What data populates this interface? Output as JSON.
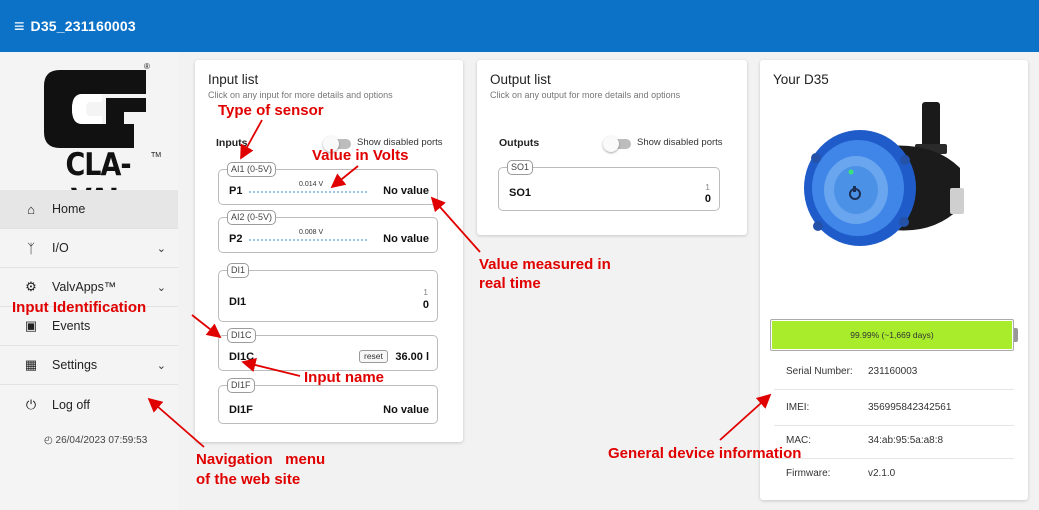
{
  "header": {
    "title": "D35_231160003",
    "menu_icon": "hamburger-icon",
    "color": "#0b72c7"
  },
  "logo": {
    "text": "CLA-VAL",
    "registered": "®",
    "trademark": "TM"
  },
  "sidebar": {
    "items": [
      {
        "label": "Home",
        "icon": "home-icon"
      },
      {
        "label": "I/O",
        "icon": "io-icon"
      },
      {
        "label": "ValvApps™",
        "icon": "valvapps-icon"
      },
      {
        "label": "Events",
        "icon": "calendar-icon"
      },
      {
        "label": "Settings",
        "icon": "settings-icon"
      },
      {
        "label": "Log off",
        "icon": "power-icon"
      }
    ],
    "timestamp": "26/04/2023 07:59:53"
  },
  "input_list": {
    "title": "Input list",
    "subtitle": "Click on any input for more details and options",
    "section": "Inputs",
    "toggle_label": "Show disabled ports",
    "ports": [
      {
        "tag": "AI1 (0-5V)",
        "name": "P1",
        "volt": "0.014 V",
        "value": "No value"
      },
      {
        "tag": "AI2 (0-5V)",
        "name": "P2",
        "volt": "0.008 V",
        "value": "No value"
      },
      {
        "tag": "DI1",
        "name": "DI1",
        "count_small": "1",
        "count_big": "0"
      },
      {
        "tag": "DI1C",
        "name": "DI1C",
        "reset": "reset",
        "value": "36.00 l"
      },
      {
        "tag": "DI1F",
        "name": "DI1F",
        "value": "No value"
      }
    ]
  },
  "output_list": {
    "title": "Output list",
    "subtitle": "Click on any output for more details and options",
    "section": "Outputs",
    "toggle_label": "Show disabled ports",
    "ports": [
      {
        "tag": "SO1",
        "name": "SO1",
        "count_small": "1",
        "count_big": "0"
      }
    ]
  },
  "device": {
    "title": "Your D35",
    "battery": {
      "level": 0.9999,
      "text": "99.99% (~1,669 days)",
      "color": "#a8ec2c"
    },
    "info": [
      {
        "key": "Serial Number:",
        "value": "231160003"
      },
      {
        "key": "IMEI:",
        "value": "356995842342561"
      },
      {
        "key": "MAC:",
        "value": "34:ab:95:5a:a8:8"
      },
      {
        "key": "Firmware:",
        "value": "v2.1.0"
      }
    ]
  },
  "annotations": {
    "color": "#e00000",
    "type_of_sensor": "Type of sensor",
    "value_in_volts": "Value in Volts",
    "value_measured_1": "Value measured in",
    "value_measured_2": "real time",
    "input_identification": "Input Identification",
    "input_name": "Input name",
    "nav_menu_1": "Navigation   menu",
    "nav_menu_2": "of the web site",
    "general_info": "General device information"
  }
}
